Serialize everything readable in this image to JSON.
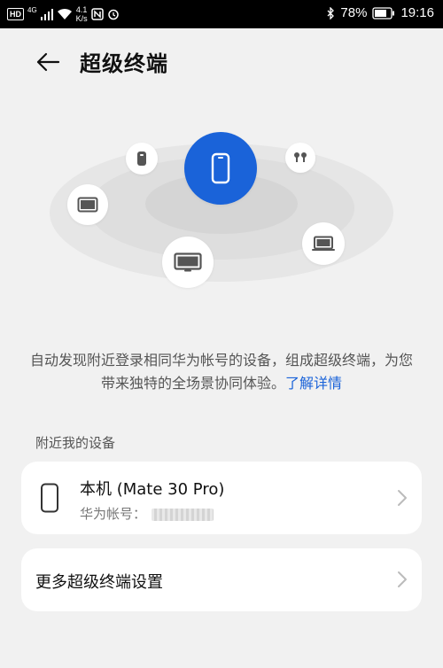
{
  "status_bar": {
    "hd_badge": "HD",
    "signal_tech": "4G",
    "net_speed_value": "4.1",
    "net_speed_unit": "K/s",
    "battery_percent": "78%",
    "time": "19:16",
    "icons": [
      "signal-icon",
      "wifi-icon",
      "nfc-icon",
      "alarm-icon",
      "bluetooth-icon",
      "battery-icon"
    ]
  },
  "header": {
    "title": "超级终端",
    "back_icon": "back-arrow-icon"
  },
  "hero": {
    "center_device": "phone-icon",
    "devices": [
      "speaker-icon",
      "earbuds-icon",
      "tablet-icon",
      "laptop-icon",
      "tv-icon"
    ],
    "accent_color": "#1a63d9"
  },
  "description": {
    "text": "自动发现附近登录相同华为帐号的设备，组成超级终端，为您带来独特的全场景协同体验。",
    "link": "了解详情"
  },
  "nearby": {
    "section_title": "附近我的设备",
    "device_name": "本机 (Mate 30 Pro)",
    "account_label": "华为帐号："
  },
  "more_settings": {
    "label": "更多超级终端设置"
  }
}
